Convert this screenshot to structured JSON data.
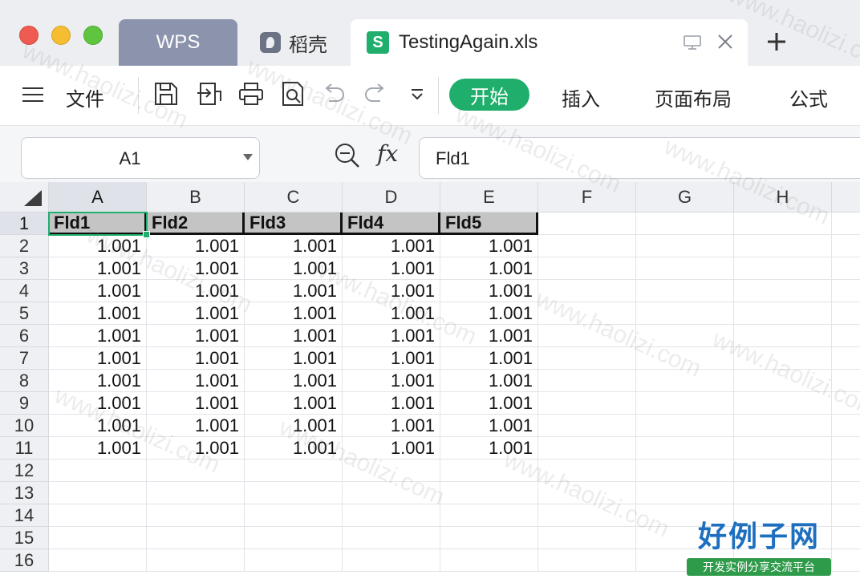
{
  "tabs": {
    "wps": "WPS",
    "daoke": "稻壳",
    "file": "TestingAgain.xls",
    "new_tab": "+"
  },
  "ribbon": {
    "file_menu": "文件",
    "start": "开始",
    "insert": "插入",
    "page_layout": "页面布局",
    "formulas": "公式"
  },
  "formula_bar": {
    "name_box": "A1",
    "fx_label": "fx",
    "content": "Fld1"
  },
  "sheet": {
    "columns": [
      "A",
      "B",
      "C",
      "D",
      "E",
      "F",
      "G",
      "H"
    ],
    "rows": [
      "1",
      "2",
      "3",
      "4",
      "5",
      "6",
      "7",
      "8",
      "9",
      "10",
      "11",
      "12",
      "13",
      "14",
      "15",
      "16"
    ],
    "header_row": [
      "Fld1",
      "Fld2",
      "Fld3",
      "Fld4",
      "Fld5"
    ],
    "data_rows": [
      [
        "1.001",
        "1.001",
        "1.001",
        "1.001",
        "1.001"
      ],
      [
        "1.001",
        "1.001",
        "1.001",
        "1.001",
        "1.001"
      ],
      [
        "1.001",
        "1.001",
        "1.001",
        "1.001",
        "1.001"
      ],
      [
        "1.001",
        "1.001",
        "1.001",
        "1.001",
        "1.001"
      ],
      [
        "1.001",
        "1.001",
        "1.001",
        "1.001",
        "1.001"
      ],
      [
        "1.001",
        "1.001",
        "1.001",
        "1.001",
        "1.001"
      ],
      [
        "1.001",
        "1.001",
        "1.001",
        "1.001",
        "1.001"
      ],
      [
        "1.001",
        "1.001",
        "1.001",
        "1.001",
        "1.001"
      ],
      [
        "1.001",
        "1.001",
        "1.001",
        "1.001",
        "1.001"
      ],
      [
        "1.001",
        "1.001",
        "1.001",
        "1.001",
        "1.001"
      ]
    ],
    "selected_cell": "A1"
  },
  "watermark": {
    "text": "www.haolizi.com",
    "logo_title": "好例子网",
    "logo_subtitle": "开发实例分享交流平台"
  },
  "colors": {
    "accent": "#1fae6b",
    "wps_tab": "#8b93ad",
    "header_fill": "#c4c4c4",
    "logo_blue": "#1e6fbf"
  }
}
